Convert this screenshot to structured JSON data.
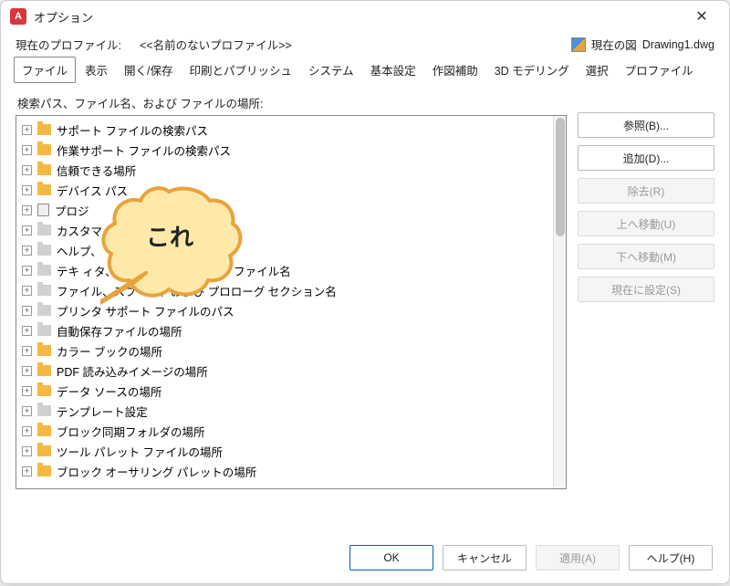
{
  "window": {
    "title": "オプション"
  },
  "profile": {
    "label": "現在のプロファイル:",
    "name": "<<名前のないプロファイル>>"
  },
  "drawing": {
    "label": "現在の図",
    "file": "Drawing1.dwg"
  },
  "tabs": [
    "ファイル",
    "表示",
    "開く/保存",
    "印刷とパブリッシュ",
    "システム",
    "基本設定",
    "作図補助",
    "3D モデリング",
    "選択",
    "プロファイル"
  ],
  "section_label": "検索パス、ファイル名、および ファイルの場所:",
  "tree": [
    {
      "icon": "folder",
      "label": "サポート ファイルの検索パス"
    },
    {
      "icon": "folder",
      "label": "作業サポート ファイルの検索パス"
    },
    {
      "icon": "folder",
      "label": "信頼できる場所"
    },
    {
      "icon": "folder",
      "label": "デバイス                         パス"
    },
    {
      "icon": "doc",
      "label": "プロジ"
    },
    {
      "icon": "gray",
      "label": "カスタマ"
    },
    {
      "icon": "gray",
      "label": "ヘルプ、"
    },
    {
      "icon": "gray",
      "label": "テキ        ィタ、辞書、およびフォント ファイル名"
    },
    {
      "icon": "gray",
      "label": "   ファイル、スプーラ、および プロローグ セクション名"
    },
    {
      "icon": "gray",
      "label": "プリンタ サポート ファイルのパス"
    },
    {
      "icon": "gray",
      "label": "自動保存ファイルの場所"
    },
    {
      "icon": "folder",
      "label": "カラー ブックの場所"
    },
    {
      "icon": "folder-outline",
      "label": "PDF 読み込みイメージの場所"
    },
    {
      "icon": "folder-outline",
      "label": "データ ソースの場所"
    },
    {
      "icon": "gray",
      "label": "テンプレート設定"
    },
    {
      "icon": "folder",
      "label": "ブロック同期フォルダの場所"
    },
    {
      "icon": "folder",
      "label": "ツール パレット ファイルの場所"
    },
    {
      "icon": "folder",
      "label": "ブロック オーサリング パレットの場所"
    }
  ],
  "buttons": {
    "browse": "参照(B)...",
    "add": "追加(D)...",
    "remove": "除去(R)",
    "moveup": "上へ移動(U)",
    "movedown": "下へ移動(M)",
    "setcurrent": "現在に設定(S)"
  },
  "footer": {
    "ok": "OK",
    "cancel": "キャンセル",
    "apply": "適用(A)",
    "help": "ヘルプ(H)"
  },
  "callout": {
    "text": "これ"
  }
}
